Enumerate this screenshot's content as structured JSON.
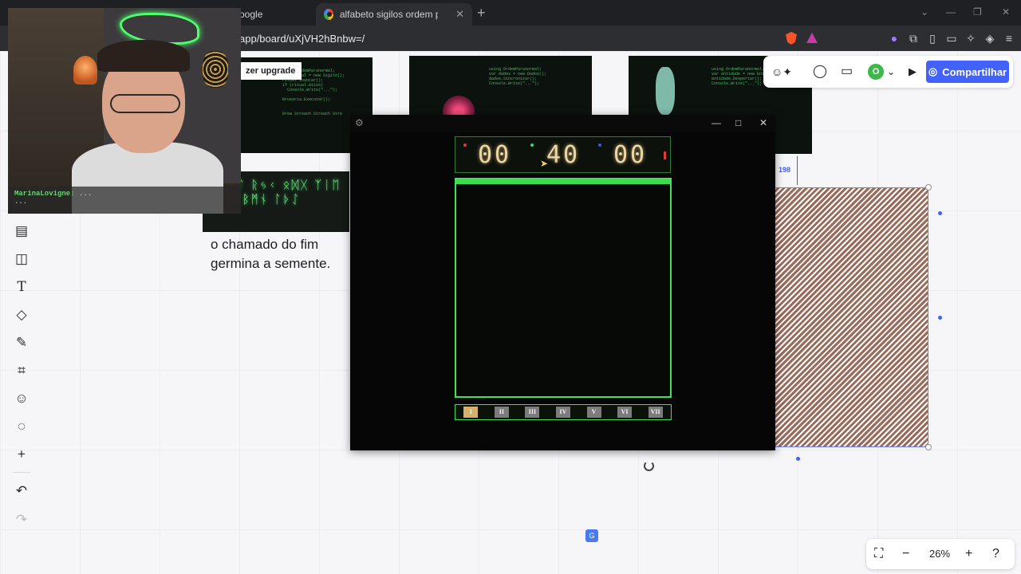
{
  "browser": {
    "tabs": [
      {
        "title": "oogle"
      },
      {
        "title": "alfabeto sigilos ordem paranormal - Pesquis"
      }
    ],
    "url": "app/board/uXjVH2hBnbw=/"
  },
  "board": {
    "upgrade_label": "zer upgrade",
    "caption_lines": [
      "o chamado do fim",
      "germina a semente."
    ],
    "share_label": "Compartilhar",
    "avatar_initial": "O",
    "dimension_label": "198",
    "zoom_level": "26%",
    "glyph_text": "ᛈᚨᛊᛏ ᚱᛃᚲ ᛟᛞᚷ ᛉᛁᛖ ᚹᚺᛜ ᛒᛗᚾ ᛚᚦᛇ"
  },
  "game": {
    "timer": {
      "left": "00",
      "center": "40",
      "right": "00"
    },
    "buttons": [
      "I",
      "II",
      "III",
      "IV",
      "V",
      "VI",
      "VII"
    ]
  },
  "stream": {
    "chat_user": "MarinaLovigne:",
    "chat_text": "...",
    "chat_cont": "..."
  },
  "colors": {
    "accent": "#4262ff",
    "neon_green": "#45e05a"
  }
}
